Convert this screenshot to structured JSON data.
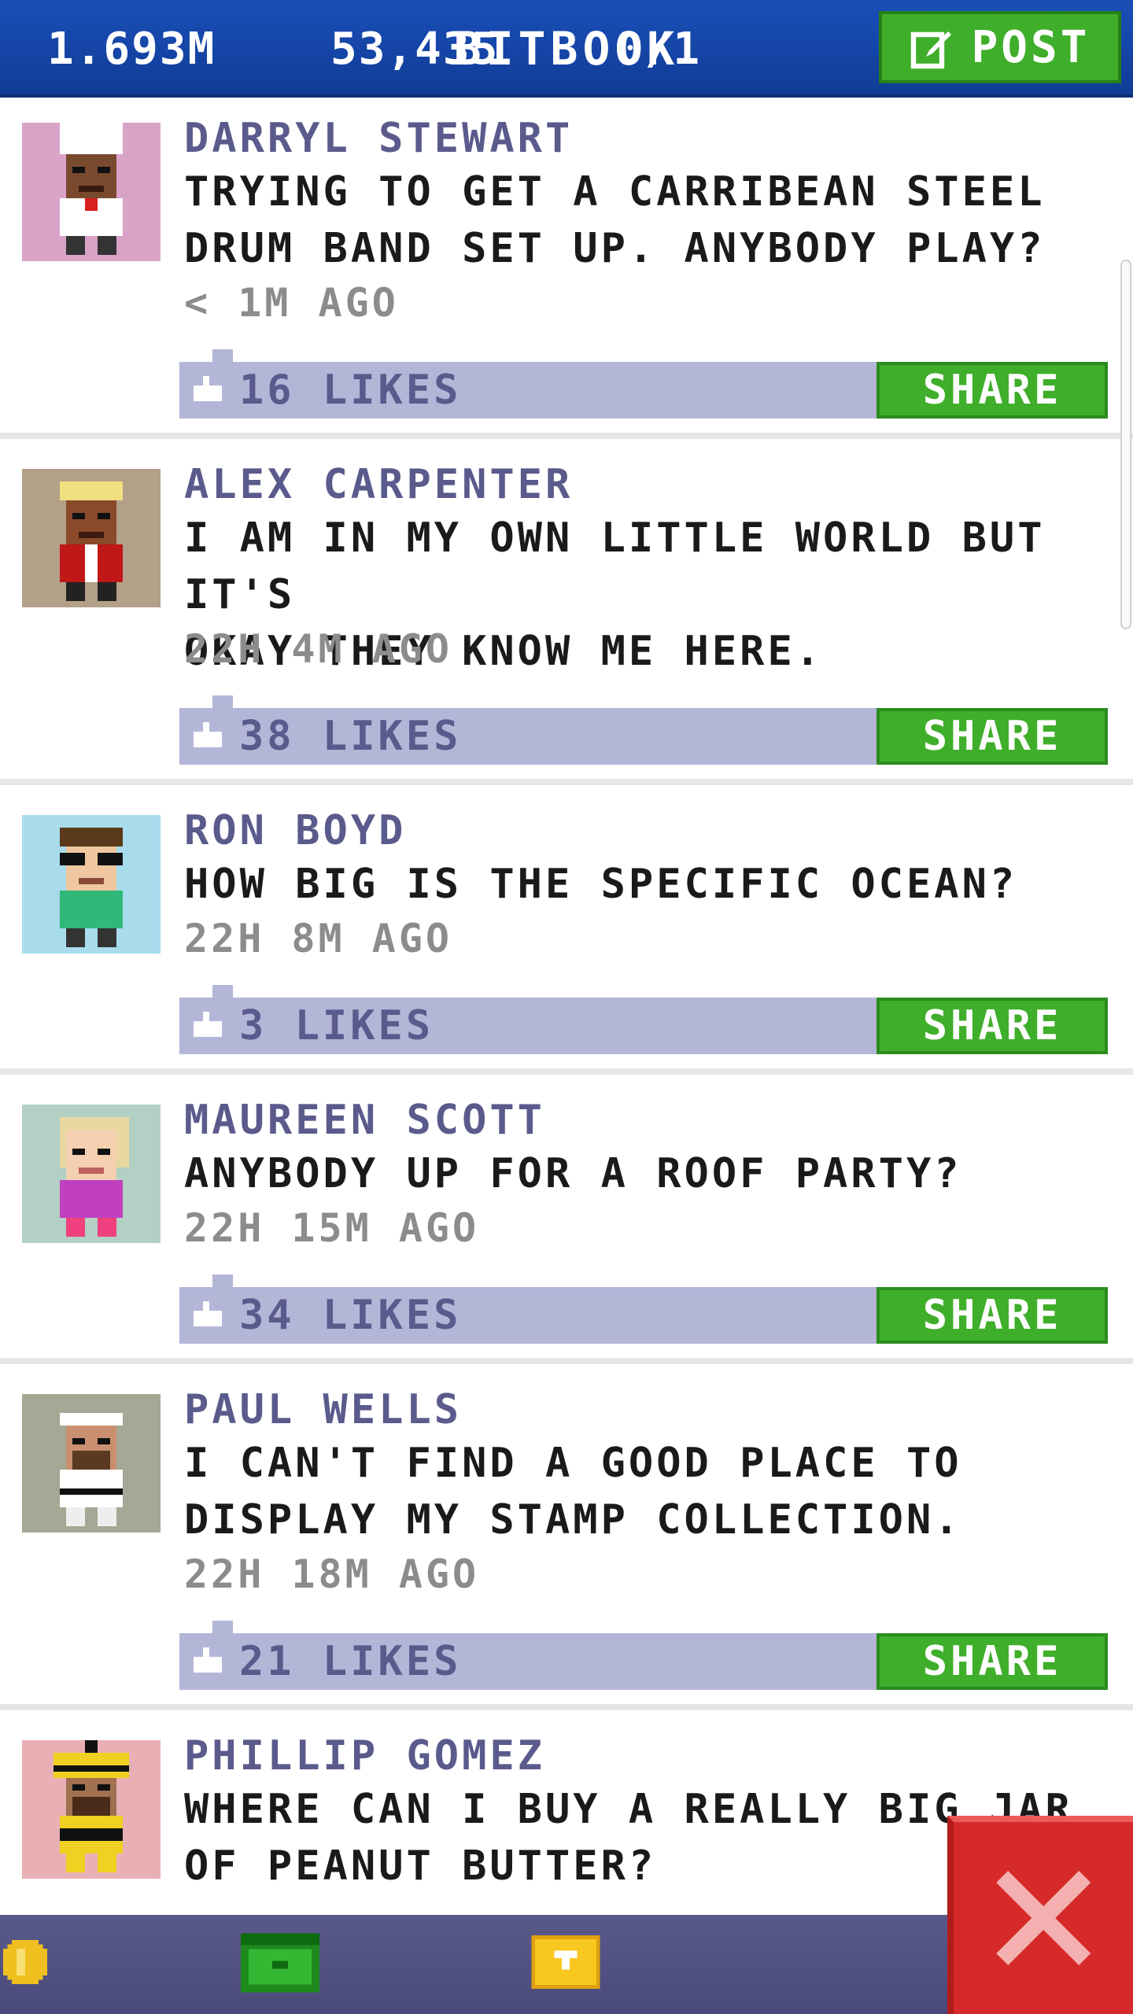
{
  "header": {
    "title": "BITBOOK",
    "post_label": "POST"
  },
  "posts": [
    {
      "name": "DARRYL STEWART",
      "lines": [
        "TRYING TO GET A CARRIBEAN STEEL",
        "DRUM BAND SET UP. ANYBODY PLAY?"
      ],
      "time": "< 1M AGO",
      "likes": "16 LIKES",
      "share": "SHARE",
      "avatar_bg": "#d9a3c8"
    },
    {
      "name": "ALEX CARPENTER",
      "lines": [
        "I AM IN MY OWN LITTLE WORLD BUT IT'S",
        "OKAY THEY KNOW ME HERE."
      ],
      "time": "22H 4M AGO",
      "likes": "38 LIKES",
      "share": "SHARE",
      "avatar_bg": "#b3a088"
    },
    {
      "name": "RON BOYD",
      "lines": [
        "HOW BIG IS THE SPECIFIC OCEAN?"
      ],
      "time": "22H 8M AGO",
      "likes": "3 LIKES",
      "share": "SHARE",
      "avatar_bg": "#a8dcec"
    },
    {
      "name": "MAUREEN SCOTT",
      "lines": [
        "ANYBODY UP FOR A ROOF PARTY?"
      ],
      "time": "22H 15M AGO",
      "likes": "34 LIKES",
      "share": "SHARE",
      "avatar_bg": "#b2d0c4"
    },
    {
      "name": "PAUL WELLS",
      "lines": [
        "I CAN'T FIND A GOOD PLACE TO",
        "DISPLAY MY STAMP COLLECTION."
      ],
      "time": "22H 18M AGO",
      "likes": "21 LIKES",
      "share": "SHARE",
      "avatar_bg": "#a4a894"
    },
    {
      "name": "PHILLIP GOMEZ",
      "lines": [
        "WHERE CAN I BUY A REALLY BIG JAR",
        "OF PEANUT BUTTER?"
      ],
      "avatar_bg": "#e8b0b4"
    }
  ],
  "footer": {
    "coins": "1.693M",
    "bux": "53,435",
    "tickets": "0/1"
  },
  "colors": {
    "header": "#1a4fb8",
    "accent_green": "#3fae2a",
    "like_bar": "#b4b6d8",
    "name_text": "#5a5a8c",
    "close_red": "#d62a2a"
  }
}
